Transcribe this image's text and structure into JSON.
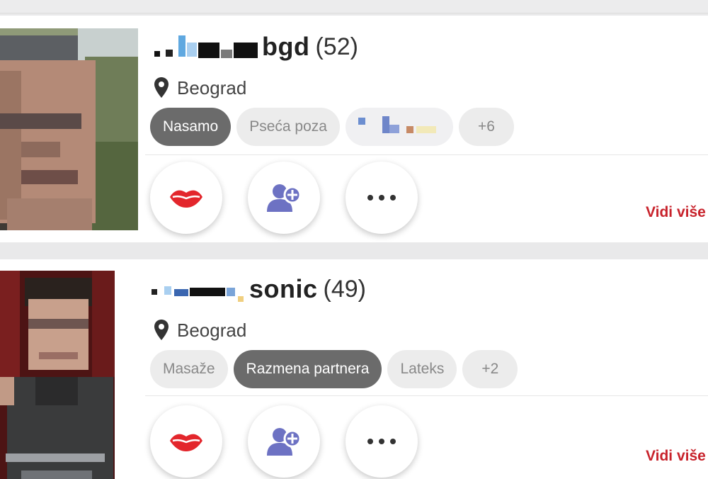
{
  "colors": {
    "accent_red": "#c8232c",
    "tag_active_bg": "#6b6b6b",
    "tag_bg": "#ececec",
    "icon_purple": "#6d72c3"
  },
  "profiles": [
    {
      "username": "bgd",
      "age": "(52)",
      "location": "Beograd",
      "location_icon": "map-pin-icon",
      "tags": [
        {
          "label": "Nasamo",
          "active": true
        },
        {
          "label": "Pseća poza",
          "active": false
        },
        {
          "label": "",
          "active": false,
          "blurred": true
        },
        {
          "label": "+6",
          "active": false
        }
      ],
      "actions": [
        "lips-icon",
        "add-friend-icon",
        "more-icon"
      ],
      "more_link": "Vidi više"
    },
    {
      "username": "sonic",
      "age": "(49)",
      "location": "Beograd",
      "location_icon": "map-pin-icon",
      "tags": [
        {
          "label": "Masaže",
          "active": false
        },
        {
          "label": "Razmena partnera",
          "active": true
        },
        {
          "label": "Lateks",
          "active": false
        },
        {
          "label": "+2",
          "active": false
        }
      ],
      "actions": [
        "lips-icon",
        "add-friend-icon",
        "more-icon"
      ],
      "more_link": "Vidi više"
    }
  ]
}
